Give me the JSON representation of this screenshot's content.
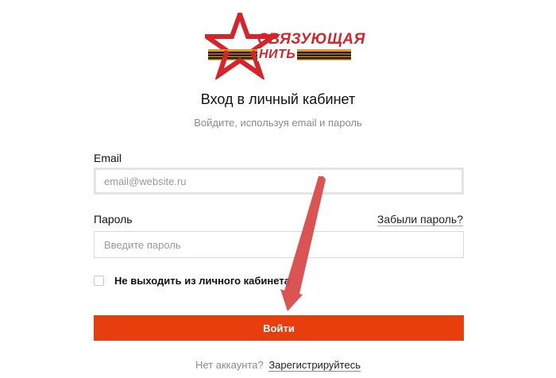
{
  "logo": {
    "line1": "СВЯЗУЮЩАЯ",
    "line2": "НИТЬ",
    "star_color": "#d8232a",
    "ribbon_colors": [
      "#e8961e",
      "#1a1a1a"
    ]
  },
  "header": {
    "title": "Вход в личный кабинет",
    "subtitle": "Войдите, используя email и пароль"
  },
  "form": {
    "email_label": "Email",
    "email_placeholder": "email@website.ru",
    "email_value": "",
    "password_label": "Пароль",
    "forgot_link": "Забыли пароль?",
    "password_placeholder": "Введите пароль",
    "password_value": "",
    "remember_label": "Не выходить из личного кабинета",
    "remember_checked": false,
    "submit_label": "Войти"
  },
  "footer": {
    "no_account": "Нет аккаунта?",
    "register_link": "Зарегистрируйтесь"
  },
  "colors": {
    "accent": "#e83d0c",
    "annotation_arrow": "#d94a4a"
  },
  "icons": {
    "logo": "red-star-ribbon-logo",
    "annotation": "pointer-arrow"
  }
}
